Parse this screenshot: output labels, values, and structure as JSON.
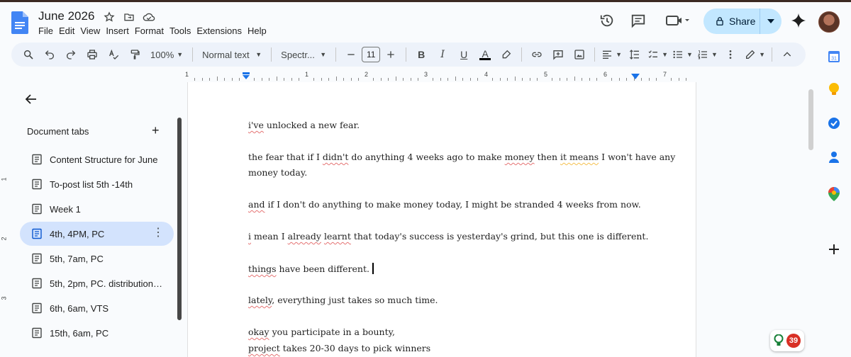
{
  "document": {
    "title": "June 2026",
    "menu": [
      "File",
      "Edit",
      "View",
      "Insert",
      "Format",
      "Tools",
      "Extensions",
      "Help"
    ]
  },
  "header": {
    "share_label": "Share"
  },
  "toolbar": {
    "zoom": "100%",
    "style": "Normal text",
    "font": "Spectr...",
    "font_size": "11"
  },
  "ruler": {
    "marks": [
      "1",
      "1",
      "2",
      "3",
      "4",
      "5",
      "6",
      "7"
    ],
    "vertical_marks": [
      "1",
      "2",
      "3"
    ]
  },
  "tabs_panel": {
    "heading": "Document tabs",
    "add": "+",
    "items": [
      {
        "label": "Content Structure for June",
        "active": false
      },
      {
        "label": "To-post list 5th -14th",
        "active": false
      },
      {
        "label": "Week 1",
        "active": false
      },
      {
        "label": "4th, 4PM, PC",
        "active": true
      },
      {
        "label": "5th, 7am, PC",
        "active": false
      },
      {
        "label": "5th, 2pm, PC. distribution ...",
        "active": false
      },
      {
        "label": "6th, 6am, VTS",
        "active": false
      },
      {
        "label": "15th, 6am, PC",
        "active": false
      }
    ]
  },
  "body": {
    "p1": [
      "i've",
      " unlocked a new fear."
    ],
    "p2": [
      "the fear that if I ",
      "didn't",
      " do anything 4 weeks ago to make ",
      "money",
      " then ",
      "it means",
      " I won't have any"
    ],
    "p2b": "money today.",
    "p3": [
      "and",
      " if I don't do anything to make money today, I might be stranded 4 weeks from now."
    ],
    "p4": [
      "i",
      " mean I ",
      "already",
      " ",
      "learnt",
      " that today's success is yesterday's grind, but this one is different."
    ],
    "p5": [
      "things",
      " have been different."
    ],
    "p6": [
      "lately",
      ", everything just takes so much time."
    ],
    "p7": [
      "okay",
      " you participate in a bounty,"
    ],
    "p8": [
      "project",
      " takes 20-30 days to pick winners"
    ]
  },
  "grammar_badge": {
    "count": "39"
  },
  "colors": {
    "accent": "#c2e7ff",
    "active_tab": "#d3e3fd",
    "toolbar_bg": "#edf2fa",
    "badge": "#d93025"
  }
}
